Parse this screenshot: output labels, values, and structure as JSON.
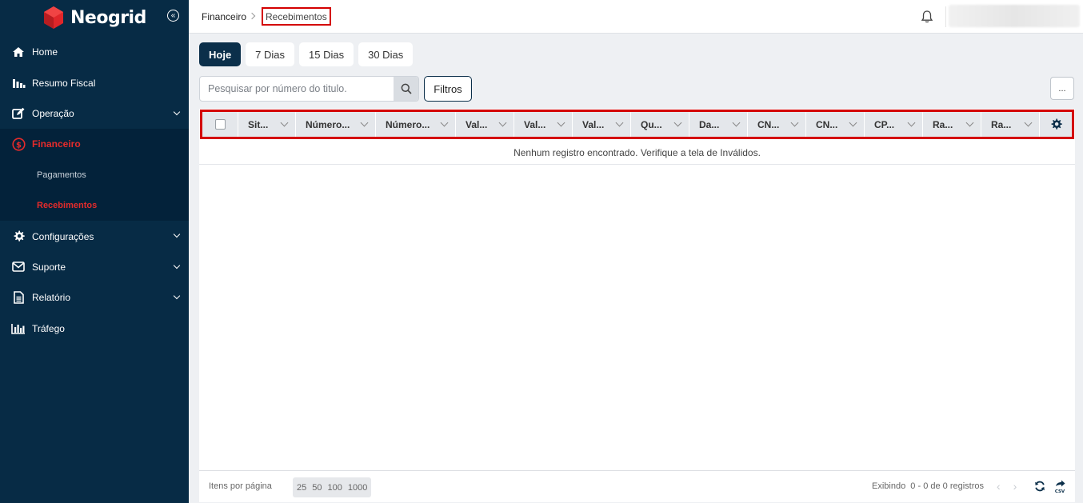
{
  "app": {
    "name": "Neogrid"
  },
  "sidebar": {
    "items": [
      {
        "label": "Home",
        "icon": "home-icon"
      },
      {
        "label": "Resumo Fiscal",
        "icon": "bar-chart-icon"
      },
      {
        "label": "Operação",
        "icon": "edit-icon",
        "expandable": true
      },
      {
        "label": "Financeiro",
        "icon": "dollar-icon",
        "active": true
      },
      {
        "label": "Configurações",
        "icon": "gear-icon",
        "expandable": true
      },
      {
        "label": "Suporte",
        "icon": "envelope-icon",
        "expandable": true
      },
      {
        "label": "Relatório",
        "icon": "document-icon",
        "expandable": true
      },
      {
        "label": "Tráfego",
        "icon": "chart-icon"
      }
    ],
    "sub_items": [
      {
        "label": "Pagamentos"
      },
      {
        "label": "Recebimentos",
        "active": true
      }
    ],
    "accent_color": "#e52b2b",
    "background_color": "#072b45"
  },
  "breadcrumb": {
    "parent": "Financeiro",
    "current": "Recebimentos"
  },
  "tabs": [
    {
      "label": "Hoje",
      "active": true
    },
    {
      "label": "7 Dias"
    },
    {
      "label": "15 Dias"
    },
    {
      "label": "30 Dias"
    }
  ],
  "search": {
    "placeholder": "Pesquisar por número do titulo.",
    "value": ""
  },
  "filters_button": "Filtros",
  "more_button": "...",
  "table": {
    "columns": [
      {
        "label": "Sit..."
      },
      {
        "label": "Número..."
      },
      {
        "label": "Número..."
      },
      {
        "label": "Val..."
      },
      {
        "label": "Val..."
      },
      {
        "label": "Val..."
      },
      {
        "label": "Qu..."
      },
      {
        "label": "Da..."
      },
      {
        "label": "CN..."
      },
      {
        "label": "CN..."
      },
      {
        "label": "CP..."
      },
      {
        "label": "Ra..."
      },
      {
        "label": "Ra..."
      }
    ],
    "empty_message": "Nenhum registro encontrado. Verifique a tela de Inválidos."
  },
  "footer": {
    "items_per_page_label": "Itens por página",
    "page_sizes": [
      "25",
      "50",
      "100",
      "1000"
    ],
    "showing": "Exibindo  0 - 0 de 0 registros",
    "prev": "‹",
    "next": "›"
  }
}
